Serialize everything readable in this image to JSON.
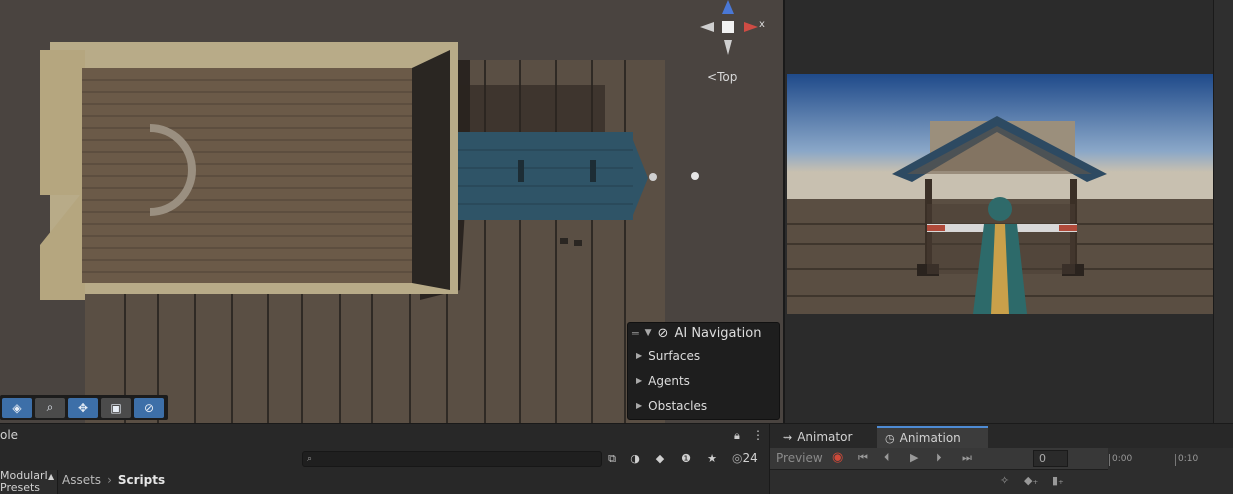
{
  "scene": {
    "orientation_label": "Top",
    "gizmo_axis_label": "x"
  },
  "ai_navigation": {
    "title": "AI Navigation",
    "items": [
      "Surfaces",
      "Agents",
      "Obstacles"
    ]
  },
  "tool_strip": {
    "icons": [
      "layers-icon",
      "search-icon",
      "move-icon",
      "camera-icon",
      "compass-icon"
    ]
  },
  "console": {
    "tab_label": "ole"
  },
  "project": {
    "left_label_line1": "ModularI",
    "left_label_line2": "Presets",
    "breadcrumb": [
      "Assets",
      "Scripts"
    ],
    "visible_count": "24",
    "search_placeholder": ""
  },
  "animation_panel": {
    "tabs": [
      "Animator",
      "Animation"
    ],
    "active_tab": "Animation",
    "preview_label": "Preview",
    "frame_value": "0",
    "time_ticks": [
      "0:00",
      "0:10"
    ]
  },
  "colors": {
    "accent": "#4e8bd4",
    "record": "#d04a3a",
    "tool_active": "#3d6fa8"
  }
}
